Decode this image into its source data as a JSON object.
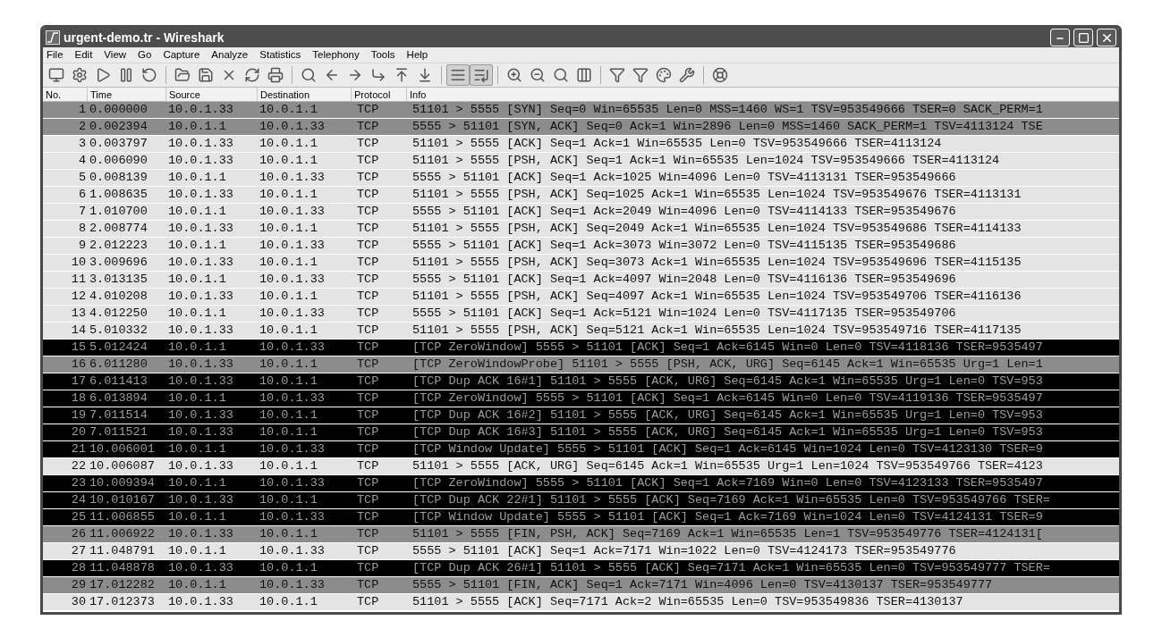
{
  "window": {
    "title": "urgent-demo.tr - Wireshark"
  },
  "menu": [
    "File",
    "Edit",
    "View",
    "Go",
    "Capture",
    "Analyze",
    "Statistics",
    "Telephony",
    "Tools",
    "Help"
  ],
  "toolbar": {
    "colorize_on": true,
    "autoscroll_on": true
  },
  "table": {
    "columns": [
      "No.",
      "Time",
      "Source",
      "Destination",
      "Protocol",
      "Info"
    ],
    "rows": [
      {
        "kind": "marked",
        "cells": [
          "1",
          "0.000000",
          "10.0.1.33",
          "10.0.1.1",
          "TCP",
          "51101 > 5555 [SYN] Seq=0 Win=65535 Len=0 MSS=1460 WS=1 TSV=953549666 TSER=0 SACK_PERM=1"
        ]
      },
      {
        "kind": "marked",
        "cells": [
          "2",
          "0.002394",
          "10.0.1.1",
          "10.0.1.33",
          "TCP",
          "5555 > 51101 [SYN, ACK] Seq=0 Ack=1 Win=2896 Len=0 MSS=1460 SACK_PERM=1 TSV=4113124 TSE"
        ]
      },
      {
        "kind": "plain",
        "cells": [
          "3",
          "0.003797",
          "10.0.1.33",
          "10.0.1.1",
          "TCP",
          "51101 > 5555 [ACK] Seq=1 Ack=1 Win=65535 Len=0 TSV=953549666 TSER=4113124"
        ]
      },
      {
        "kind": "plain",
        "cells": [
          "4",
          "0.006090",
          "10.0.1.33",
          "10.0.1.1",
          "TCP",
          "51101 > 5555 [PSH, ACK] Seq=1 Ack=1 Win=65535 Len=1024 TSV=953549666 TSER=4113124"
        ]
      },
      {
        "kind": "plain",
        "cells": [
          "5",
          "0.008139",
          "10.0.1.1",
          "10.0.1.33",
          "TCP",
          "5555 > 51101 [ACK] Seq=1 Ack=1025 Win=4096 Len=0 TSV=4113131 TSER=953549666"
        ]
      },
      {
        "kind": "plain",
        "cells": [
          "6",
          "1.008635",
          "10.0.1.33",
          "10.0.1.1",
          "TCP",
          "51101 > 5555 [PSH, ACK] Seq=1025 Ack=1 Win=65535 Len=1024 TSV=953549676 TSER=4113131"
        ]
      },
      {
        "kind": "plain",
        "cells": [
          "7",
          "1.010700",
          "10.0.1.1",
          "10.0.1.33",
          "TCP",
          "5555 > 51101 [ACK] Seq=1 Ack=2049 Win=4096 Len=0 TSV=4114133 TSER=953549676"
        ]
      },
      {
        "kind": "plain",
        "cells": [
          "8",
          "2.008774",
          "10.0.1.33",
          "10.0.1.1",
          "TCP",
          "51101 > 5555 [PSH, ACK] Seq=2049 Ack=1 Win=65535 Len=1024 TSV=953549686 TSER=4114133"
        ]
      },
      {
        "kind": "plain",
        "cells": [
          "9",
          "2.012223",
          "10.0.1.1",
          "10.0.1.33",
          "TCP",
          "5555 > 51101 [ACK] Seq=1 Ack=3073 Win=3072 Len=0 TSV=4115135 TSER=953549686"
        ]
      },
      {
        "kind": "plain",
        "cells": [
          "10",
          "3.009696",
          "10.0.1.33",
          "10.0.1.1",
          "TCP",
          "51101 > 5555 [PSH, ACK] Seq=3073 Ack=1 Win=65535 Len=1024 TSV=953549696 TSER=4115135"
        ]
      },
      {
        "kind": "plain",
        "cells": [
          "11",
          "3.013135",
          "10.0.1.1",
          "10.0.1.33",
          "TCP",
          "5555 > 51101 [ACK] Seq=1 Ack=4097 Win=2048 Len=0 TSV=4116136 TSER=953549696"
        ]
      },
      {
        "kind": "plain",
        "cells": [
          "12",
          "4.010208",
          "10.0.1.33",
          "10.0.1.1",
          "TCP",
          "51101 > 5555 [PSH, ACK] Seq=4097 Ack=1 Win=65535 Len=1024 TSV=953549706 TSER=4116136"
        ]
      },
      {
        "kind": "plain",
        "cells": [
          "13",
          "4.012250",
          "10.0.1.1",
          "10.0.1.33",
          "TCP",
          "5555 > 51101 [ACK] Seq=1 Ack=5121 Win=1024 Len=0 TSV=4117135 TSER=953549706"
        ]
      },
      {
        "kind": "plain",
        "cells": [
          "14",
          "5.010332",
          "10.0.1.33",
          "10.0.1.1",
          "TCP",
          "51101 > 5555 [PSH, ACK] Seq=5121 Ack=1 Win=65535 Len=1024 TSV=953549716 TSER=4117135"
        ]
      },
      {
        "kind": "dark",
        "cells": [
          "15",
          "5.012424",
          "10.0.1.1",
          "10.0.1.33",
          "TCP",
          "[TCP ZeroWindow] 5555 > 51101 [ACK] Seq=1 Ack=6145 Win=0 Len=0 TSV=4118136 TSER=9535497"
        ]
      },
      {
        "kind": "marked",
        "cells": [
          "16",
          "6.011280",
          "10.0.1.33",
          "10.0.1.1",
          "TCP",
          "[TCP ZeroWindowProbe] 51101 > 5555 [PSH, ACK, URG] Seq=6145 Ack=1 Win=65535 Urg=1 Len=1"
        ]
      },
      {
        "kind": "dark",
        "cells": [
          "17",
          "6.011413",
          "10.0.1.33",
          "10.0.1.1",
          "TCP",
          "[TCP Dup ACK 16#1] 51101 > 5555 [ACK, URG] Seq=6145 Ack=1 Win=65535 Urg=1 Len=0 TSV=953"
        ]
      },
      {
        "kind": "dark",
        "cells": [
          "18",
          "6.013894",
          "10.0.1.1",
          "10.0.1.33",
          "TCP",
          "[TCP ZeroWindow] 5555 > 51101 [ACK] Seq=1 Ack=6145 Win=0 Len=0 TSV=4119136 TSER=9535497"
        ]
      },
      {
        "kind": "dark",
        "cells": [
          "19",
          "7.011514",
          "10.0.1.33",
          "10.0.1.1",
          "TCP",
          "[TCP Dup ACK 16#2] 51101 > 5555 [ACK, URG] Seq=6145 Ack=1 Win=65535 Urg=1 Len=0 TSV=953"
        ]
      },
      {
        "kind": "dark",
        "cells": [
          "20",
          "7.011521",
          "10.0.1.33",
          "10.0.1.1",
          "TCP",
          "[TCP Dup ACK 16#3] 51101 > 5555 [ACK, URG] Seq=6145 Ack=1 Win=65535 Urg=1 Len=0 TSV=953"
        ]
      },
      {
        "kind": "dark",
        "cells": [
          "21",
          "10.006001",
          "10.0.1.1",
          "10.0.1.33",
          "TCP",
          "[TCP Window Update] 5555 > 51101 [ACK] Seq=1 Ack=6145 Win=1024 Len=0 TSV=4123130 TSER=9"
        ]
      },
      {
        "kind": "plain",
        "cells": [
          "22",
          "10.006087",
          "10.0.1.33",
          "10.0.1.1",
          "TCP",
          "51101 > 5555 [ACK, URG] Seq=6145 Ack=1 Win=65535 Urg=1 Len=1024 TSV=953549766 TSER=4123"
        ]
      },
      {
        "kind": "dark",
        "cells": [
          "23",
          "10.009394",
          "10.0.1.1",
          "10.0.1.33",
          "TCP",
          "[TCP ZeroWindow] 5555 > 51101 [ACK] Seq=1 Ack=7169 Win=0 Len=0 TSV=4123133 TSER=9535497"
        ]
      },
      {
        "kind": "dark",
        "cells": [
          "24",
          "10.010167",
          "10.0.1.33",
          "10.0.1.1",
          "TCP",
          "[TCP Dup ACK 22#1] 51101 > 5555 [ACK] Seq=7169 Ack=1 Win=65535 Len=0 TSV=953549766 TSER="
        ]
      },
      {
        "kind": "dark",
        "cells": [
          "25",
          "11.006855",
          "10.0.1.1",
          "10.0.1.33",
          "TCP",
          "[TCP Window Update] 5555 > 51101 [ACK] Seq=1 Ack=7169 Win=1024 Len=0 TSV=4124131 TSER=9"
        ]
      },
      {
        "kind": "marked",
        "cells": [
          "26",
          "11.006922",
          "10.0.1.33",
          "10.0.1.1",
          "TCP",
          "51101 > 5555 [FIN, PSH, ACK] Seq=7169 Ack=1 Win=65535 Len=1 TSV=953549776 TSER=4124131["
        ]
      },
      {
        "kind": "plain",
        "cells": [
          "27",
          "11.048791",
          "10.0.1.1",
          "10.0.1.33",
          "TCP",
          "5555 > 51101 [ACK] Seq=1 Ack=7171 Win=1022 Len=0 TSV=4124173 TSER=953549776"
        ]
      },
      {
        "kind": "dark",
        "cells": [
          "28",
          "11.048878",
          "10.0.1.33",
          "10.0.1.1",
          "TCP",
          "[TCP Dup ACK 26#1] 51101 > 5555 [ACK] Seq=7171 Ack=1 Win=65535 Len=0 TSV=953549777 TSER="
        ]
      },
      {
        "kind": "marked",
        "cells": [
          "29",
          "17.012282",
          "10.0.1.1",
          "10.0.1.33",
          "TCP",
          "5555 > 51101 [FIN, ACK] Seq=1 Ack=7171 Win=4096 Len=0 TSV=4130137 TSER=953549777"
        ]
      },
      {
        "kind": "plain",
        "cells": [
          "30",
          "17.012373",
          "10.0.1.33",
          "10.0.1.1",
          "TCP",
          "51101 > 5555 [ACK] Seq=7171 Ack=2 Win=65535 Len=0 TSV=953549836 TSER=4130137"
        ]
      }
    ]
  }
}
